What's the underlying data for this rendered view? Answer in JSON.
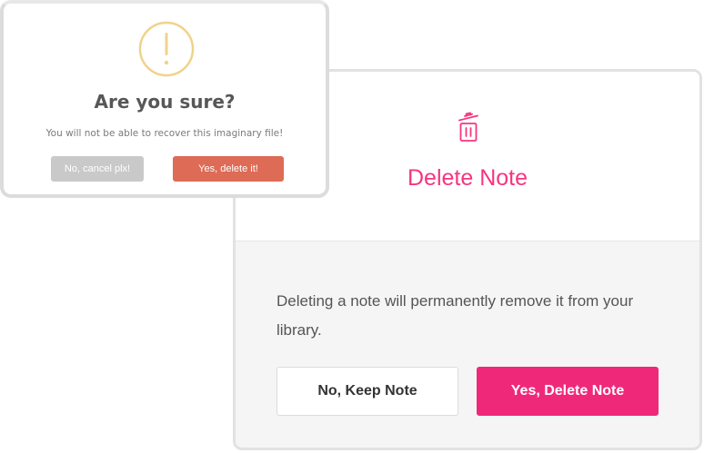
{
  "confirm_dialog": {
    "icon": "warning-circle-icon",
    "title": "Are you sure?",
    "message": "You will not be able to recover this imaginary file!",
    "cancel_label": "No, cancel plx!",
    "confirm_label": "Yes, delete it!",
    "colors": {
      "icon": "#f0d38a",
      "confirm_button": "#dd6b55",
      "cancel_button": "#c9c9c9"
    }
  },
  "delete_note_dialog": {
    "icon": "trash-icon",
    "title": "Delete Note",
    "message": "Deleting a note will permanently remove it from your library.",
    "cancel_label": "No, Keep Note",
    "confirm_label": "Yes, Delete Note",
    "colors": {
      "accent": "#f5367f",
      "confirm_button": "#f0287a"
    }
  }
}
